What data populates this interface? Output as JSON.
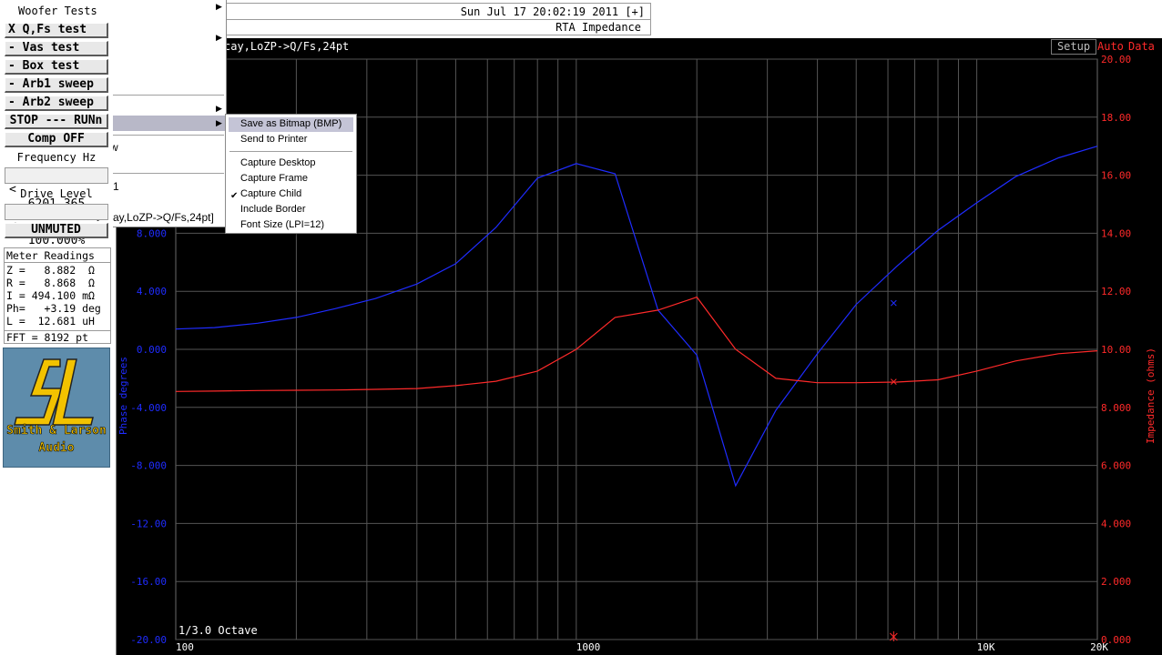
{
  "header": {
    "datetime": "Sun Jul 17 20:02:19 2011 [+]",
    "mode_title": "RTA Impedance"
  },
  "graph": {
    "subtitle": "cay,LoZP->Q/Fs,24pt",
    "setup_label": "Setup",
    "auto_label": "Auto",
    "data_label": "Data",
    "octave_label": "1/3.0 Octave"
  },
  "panel": {
    "woofer_tests": "Woofer Tests",
    "buttons": {
      "qfs": "X Q,Fs test",
      "vas": "- Vas test",
      "box": "- Box test",
      "arb1": "- Arb1 sweep",
      "arb2": "- Arb2 sweep",
      "stop_run": "STOP --- RUNn",
      "comp": "Comp OFF",
      "unmuted": "UNMUTED"
    },
    "frequency_label": "Frequency Hz",
    "frequency": {
      "dec": "<",
      "value": "6201.365",
      "inc": ">"
    },
    "drive_label": "Drive Level",
    "drive": {
      "dec": "<",
      "value": "100.000%",
      "inc": ">"
    }
  },
  "meters": {
    "title": "Meter Readings",
    "lines": [
      "Z =   8.882  Ω",
      "R =   8.868  Ω",
      "I = 494.100 mΩ",
      "Ph=   +3.19 deg",
      "L =  12.681 uH"
    ],
    "fft": "FFT = 8192 pt"
  },
  "logo": {
    "line1": "Smith & Larson",
    "line2": "Audio"
  },
  "menu": {
    "fragments": {
      "w": "w",
      "one": "1",
      "cay": "cay,LoZP->Q/Fs,24pt]"
    },
    "submenu": [
      "Save as Bitmap (BMP)",
      "Send to Printer",
      "Capture Desktop",
      "Capture Frame",
      "Capture Child",
      "Include Border",
      "Font Size (LPI=12)"
    ],
    "checked_item": "Capture Child"
  },
  "chart_data": {
    "type": "line",
    "title": "",
    "xlabel": "",
    "ylabel_left": "Phase degrees",
    "ylabel_right": "Impedance (ohms)",
    "x_scale": "log",
    "xlim": [
      100,
      20000
    ],
    "ylim_left": [
      -20,
      20
    ],
    "ylim_right": [
      0,
      20
    ],
    "grid": true,
    "x_tick_labels": [
      "100",
      "1000",
      "10K",
      "20K"
    ],
    "x_ticks": [
      100,
      1000,
      10000,
      20000
    ],
    "y_left_tick_labels": [
      "-20.00",
      "-16.00",
      "-12.00",
      "-8.000",
      "-4.000",
      "0.000",
      "4.000",
      "8.000"
    ],
    "y_left_ticks": [
      -20,
      -16,
      -12,
      -8,
      -4,
      0,
      4,
      8
    ],
    "y_right_tick_labels": [
      "0.000",
      "2.000",
      "4.000",
      "6.000",
      "8.000",
      "10.00",
      "12.00",
      "14.00",
      "16.00",
      "18.00",
      "20.00"
    ],
    "y_right_ticks": [
      0,
      2,
      4,
      6,
      8,
      10,
      12,
      14,
      16,
      18,
      20
    ],
    "series": [
      {
        "name": "Phase",
        "axis": "left",
        "color": "#1f2cff",
        "x": [
          100,
          125,
          160,
          200,
          250,
          315,
          400,
          500,
          630,
          800,
          1000,
          1250,
          1600,
          2000,
          2500,
          3150,
          4000,
          5000,
          6300,
          8000,
          10000,
          12500,
          16000,
          20000
        ],
        "y": [
          1.4,
          1.5,
          1.8,
          2.2,
          2.8,
          3.5,
          4.5,
          5.9,
          8.4,
          11.8,
          12.8,
          12.1,
          2.7,
          -0.4,
          -9.4,
          -4.2,
          -0.3,
          3.1,
          5.7,
          8.2,
          10.1,
          11.9,
          13.2,
          14.0
        ],
        "marker": {
          "x": 6201.365,
          "y": 3.19
        }
      },
      {
        "name": "Impedance",
        "axis": "right",
        "color": "#ff2a2a",
        "x": [
          100,
          125,
          160,
          200,
          250,
          315,
          400,
          500,
          630,
          800,
          1000,
          1250,
          1600,
          2000,
          2500,
          3150,
          4000,
          5000,
          6300,
          8000,
          10000,
          12500,
          16000,
          20000
        ],
        "y": [
          8.55,
          8.56,
          8.58,
          8.59,
          8.6,
          8.62,
          8.65,
          8.75,
          8.9,
          9.25,
          10.0,
          11.1,
          11.35,
          11.8,
          10.0,
          9.0,
          8.85,
          8.85,
          8.87,
          8.95,
          9.25,
          9.6,
          9.85,
          9.95
        ],
        "marker": {
          "x": 6201.365,
          "y": 8.882
        }
      }
    ]
  }
}
